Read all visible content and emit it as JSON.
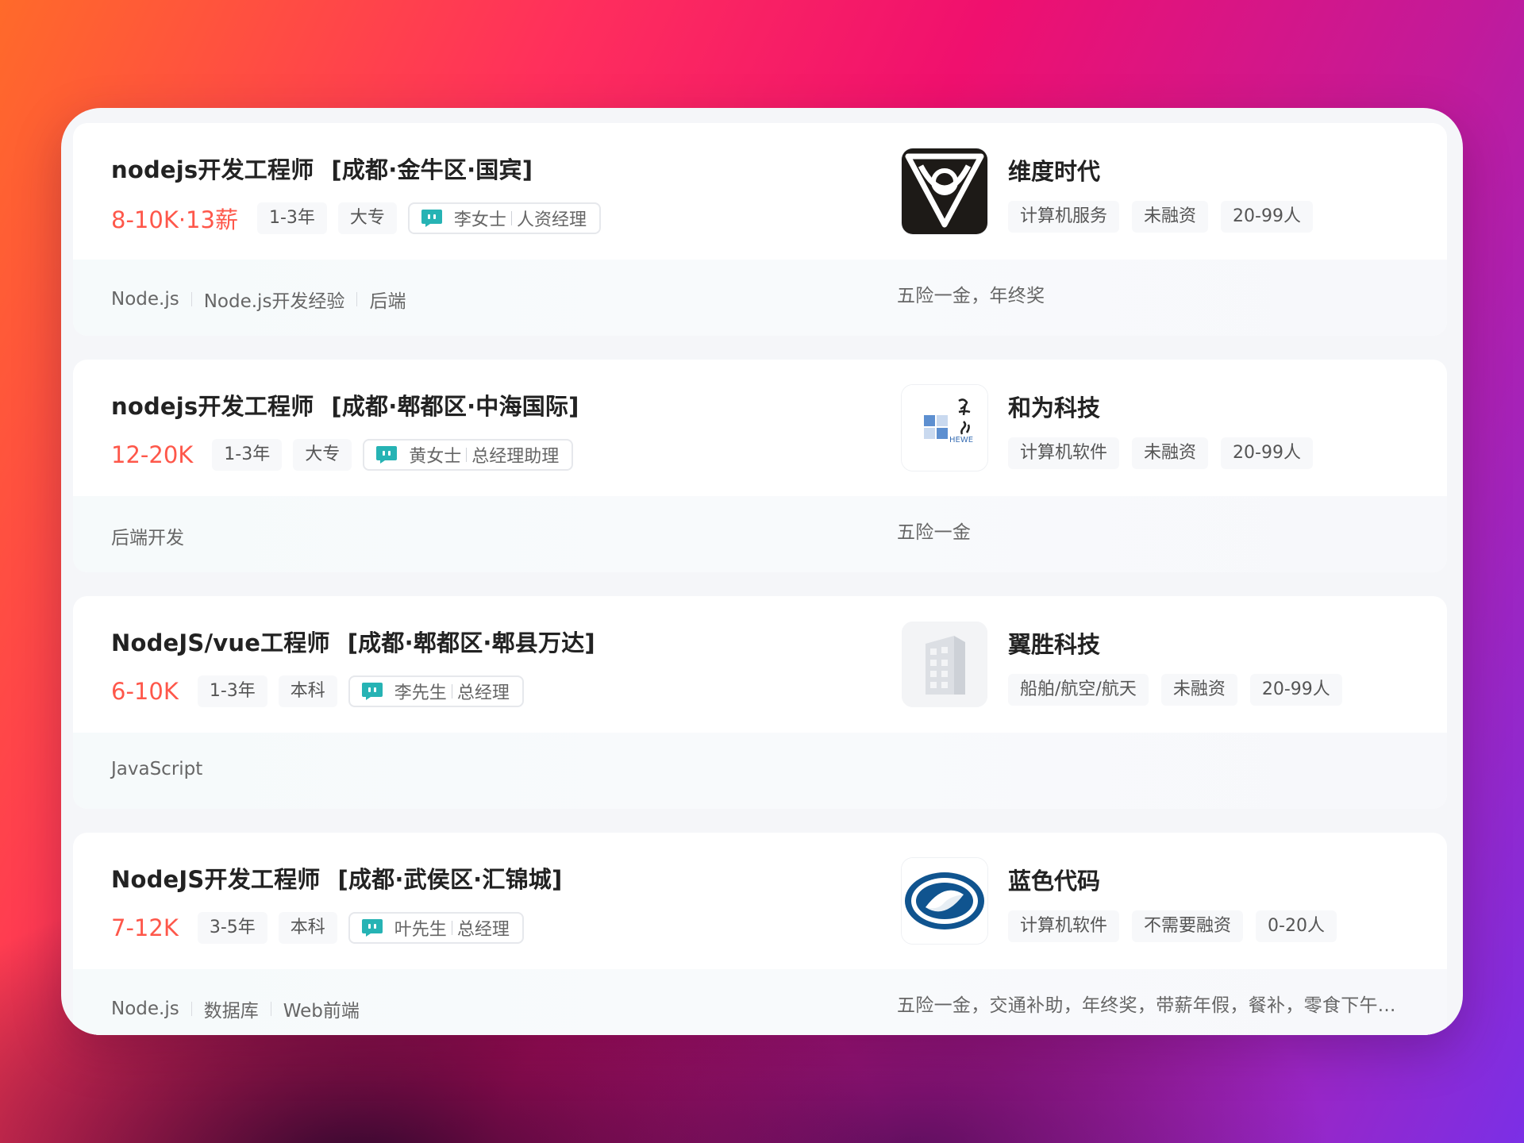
{
  "jobs": [
    {
      "title": "nodejs开发工程师",
      "location": "[成都·金牛区·国宾]",
      "salary": "8-10K·13薪",
      "experience": "1-3年",
      "education": "大专",
      "recruiter_name": "李女士",
      "recruiter_role": "人资经理",
      "skills": [
        "Node.js",
        "Node.js开发经验",
        "后端"
      ],
      "company_name": "维度时代",
      "company_tags": [
        "计算机服务",
        "未融资",
        "20-99人"
      ],
      "benefits": "五险一金，年终奖",
      "logo": "weidu-logo"
    },
    {
      "title": "nodejs开发工程师",
      "location": "[成都·郫都区·中海国际]",
      "salary": "12-20K",
      "experience": "1-3年",
      "education": "大专",
      "recruiter_name": "黄女士",
      "recruiter_role": "总经理助理",
      "skills": [
        "后端开发"
      ],
      "company_name": "和为科技",
      "company_tags": [
        "计算机软件",
        "未融资",
        "20-99人"
      ],
      "benefits": "五险一金",
      "logo": "hewei-logo",
      "logo_text": "HEWE"
    },
    {
      "title": "NodeJS/vue工程师",
      "location": "[成都·郫都区·郫县万达]",
      "salary": "6-10K",
      "experience": "1-3年",
      "education": "本科",
      "recruiter_name": "李先生",
      "recruiter_role": "总经理",
      "skills": [
        "JavaScript"
      ],
      "company_name": "翼胜科技",
      "company_tags": [
        "船舶/航空/航天",
        "未融资",
        "20-99人"
      ],
      "benefits": "",
      "logo": "building-placeholder-icon"
    },
    {
      "title": "NodeJS开发工程师",
      "location": "[成都·武侯区·汇锦城]",
      "salary": "7-12K",
      "experience": "3-5年",
      "education": "本科",
      "recruiter_name": "叶先生",
      "recruiter_role": "总经理",
      "skills": [
        "Node.js",
        "数据库",
        "Web前端"
      ],
      "company_name": "蓝色代码",
      "company_tags": [
        "计算机软件",
        "不需要融资",
        "0-20人"
      ],
      "benefits": "五险一金，交通补助，年终奖，带薪年假，餐补，零食下午...",
      "logo": "lanse-logo"
    }
  ],
  "colors": {
    "salary": "#fe574a",
    "chat_icon": "#26b3b4",
    "card_bg": "#ffffff",
    "panel_bg": "#f5f6f9"
  }
}
